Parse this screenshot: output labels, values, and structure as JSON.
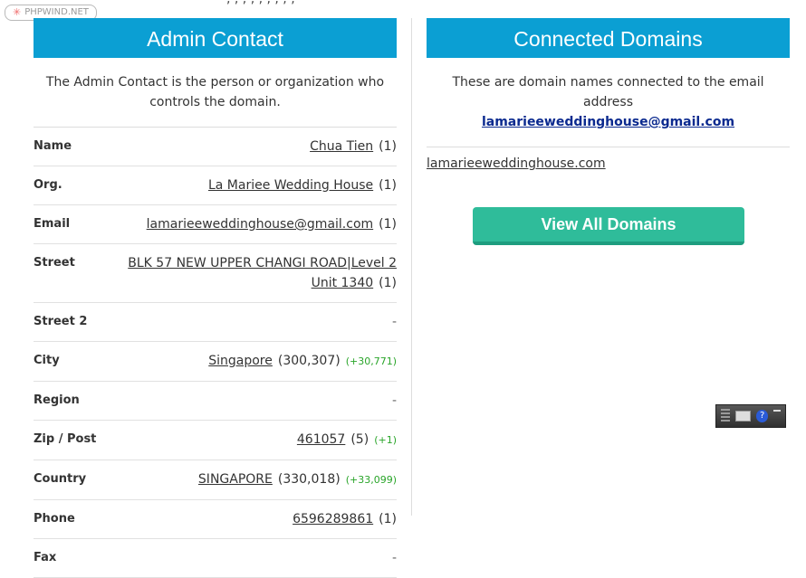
{
  "top_fragment": ", , , , , , , , ,",
  "watermark": {
    "icon": "star-icon",
    "text": "PHPWIND.NET"
  },
  "admin": {
    "title": "Admin Contact",
    "description": "The Admin Contact is the person or organization who controls the domain.",
    "rows": [
      {
        "key": "Name",
        "value": "Chua Tien",
        "count": "(1)",
        "delta": ""
      },
      {
        "key": "Org.",
        "value": "La Mariee Wedding House",
        "count": "(1)",
        "delta": ""
      },
      {
        "key": "Email",
        "value": "lamarieeweddinghouse@gmail.com",
        "count": "(1)",
        "delta": ""
      },
      {
        "key": "Street",
        "value": "BLK 57 NEW UPPER CHANGI ROAD|Level 2 Unit 1340",
        "count": "(1)",
        "delta": ""
      },
      {
        "key": "Street 2",
        "value": "-",
        "count": "",
        "delta": ""
      },
      {
        "key": "City",
        "value": "Singapore",
        "count": "(300,307)",
        "delta": "(+30,771)"
      },
      {
        "key": "Region",
        "value": "-",
        "count": "",
        "delta": ""
      },
      {
        "key": "Zip / Post",
        "value": "461057",
        "count": "(5)",
        "delta": "(+1)"
      },
      {
        "key": "Country",
        "value": "SINGAPORE",
        "count": "(330,018)",
        "delta": "(+33,099)"
      },
      {
        "key": "Phone",
        "value": "6596289861",
        "count": "(1)",
        "delta": ""
      },
      {
        "key": "Fax",
        "value": "-",
        "count": "",
        "delta": ""
      }
    ]
  },
  "domains": {
    "title": "Connected Domains",
    "description": "These are domain names connected to the email address",
    "email": "lamarieeweddinghouse@gmail.com",
    "items": [
      "lamarieeweddinghouse.com"
    ],
    "button_label": "View All Domains"
  },
  "toolbar": {
    "help_label": "?"
  },
  "colors": {
    "header": "#0b9fd3",
    "button": "#2fbc9a",
    "delta": "#2aa52a",
    "link": "#0b2a8f"
  }
}
